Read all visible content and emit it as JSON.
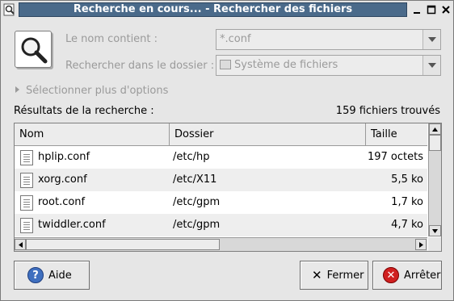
{
  "window": {
    "title": "Recherche en cours... - Rechercher des fichiers",
    "icons": {
      "app": "search-app-icon",
      "minimize": "minimize-icon",
      "maximize": "maximize-icon",
      "close": "close-icon"
    }
  },
  "form": {
    "name_label": "Le nom contient :",
    "name_value": "*.conf",
    "folder_label": "Rechercher dans le dossier :",
    "folder_value": "Système de fichiers",
    "more_options": "Sélectionner plus d'options"
  },
  "results": {
    "label": "Résultats de la recherche :",
    "count": "159 fichiers trouvés",
    "columns": [
      "Nom",
      "Dossier",
      "Taille"
    ],
    "rows": [
      {
        "name": "hplip.conf",
        "folder": "/etc/hp",
        "size": "197 octets"
      },
      {
        "name": "xorg.conf",
        "folder": "/etc/X11",
        "size": "5,5 ko"
      },
      {
        "name": "root.conf",
        "folder": "/etc/gpm",
        "size": "1,7 ko"
      },
      {
        "name": "twiddler.conf",
        "folder": "/etc/gpm",
        "size": "4,7 ko"
      }
    ]
  },
  "buttons": {
    "help": "Aide",
    "close": "Fermer",
    "stop": "Arrêter"
  }
}
